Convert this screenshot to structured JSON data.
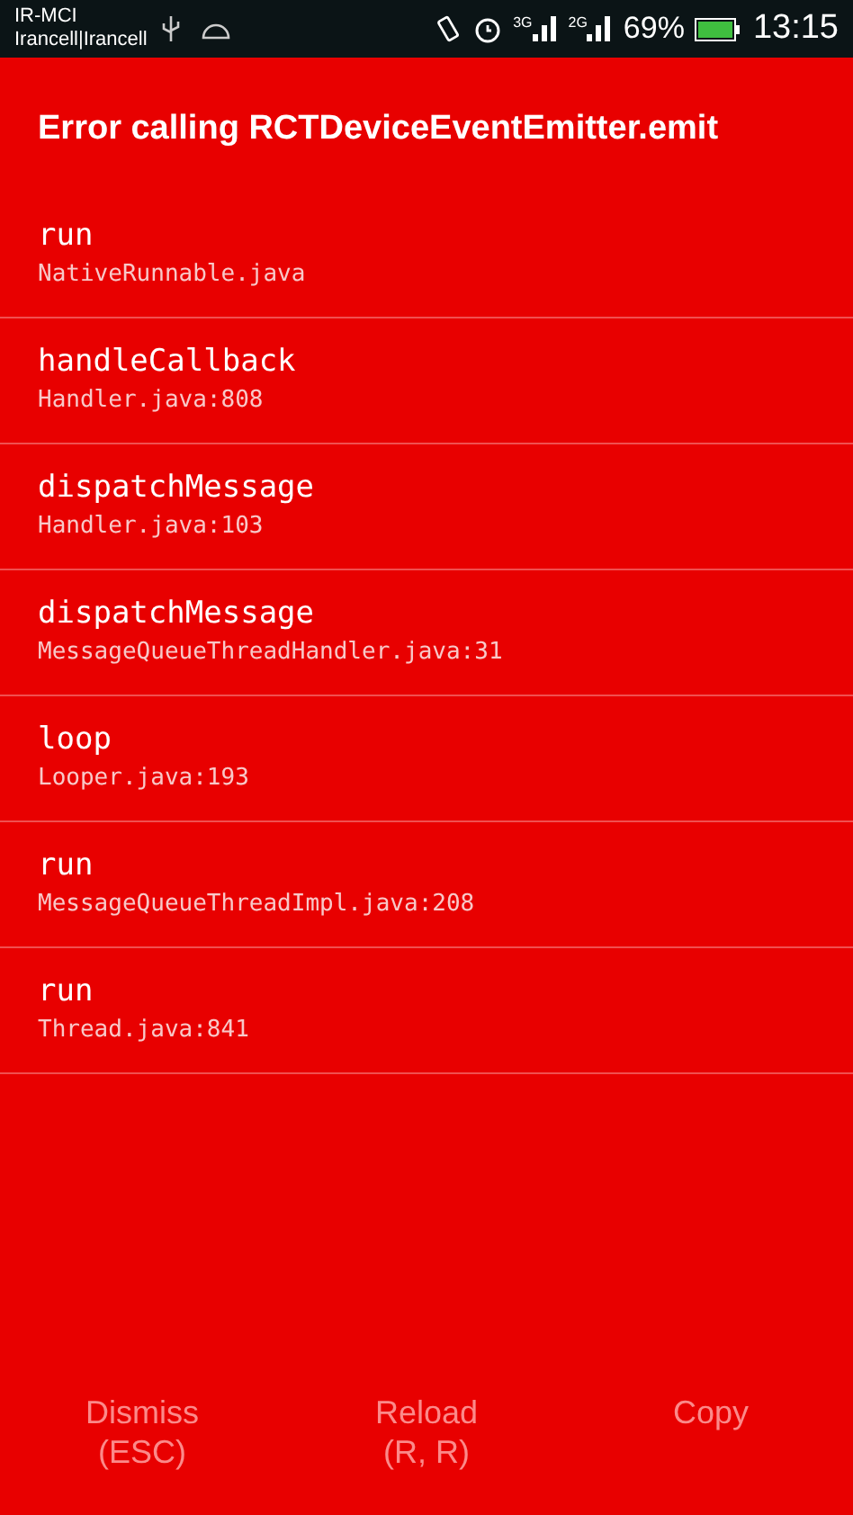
{
  "status_bar": {
    "carrier": "IR-MCI",
    "networks": "Irancell|Irancell",
    "network_labels": [
      "3G",
      "2G"
    ],
    "battery": "69%",
    "time": "13:15"
  },
  "title": "Error calling RCTDeviceEventEmitter.emit",
  "stack": [
    {
      "method": "run",
      "file": "NativeRunnable.java"
    },
    {
      "method": "handleCallback",
      "file": "Handler.java:808"
    },
    {
      "method": "dispatchMessage",
      "file": "Handler.java:103"
    },
    {
      "method": "dispatchMessage",
      "file": "MessageQueueThreadHandler.java:31"
    },
    {
      "method": "loop",
      "file": "Looper.java:193"
    },
    {
      "method": "run",
      "file": "MessageQueueThreadImpl.java:208"
    },
    {
      "method": "run",
      "file": "Thread.java:841"
    }
  ],
  "buttons": [
    "Dismiss\n(ESC)",
    "Reload\n(R, R)",
    "Copy"
  ]
}
